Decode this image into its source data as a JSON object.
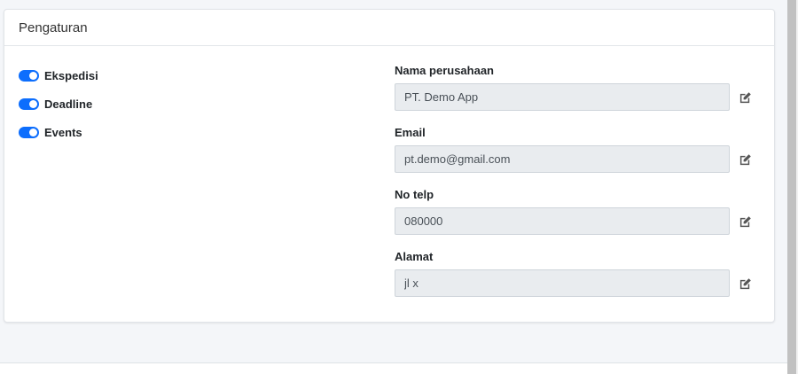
{
  "card": {
    "title": "Pengaturan"
  },
  "toggles": [
    {
      "label": "Ekspedisi",
      "enabled": true
    },
    {
      "label": "Deadline",
      "enabled": true
    },
    {
      "label": "Events",
      "enabled": true
    }
  ],
  "fields": [
    {
      "label": "Nama perusahaan",
      "value": "PT. Demo App",
      "icon": "edit-icon"
    },
    {
      "label": "Email",
      "value": "pt.demo@gmail.com",
      "icon": "edit-icon"
    },
    {
      "label": "No telp",
      "value": "080000",
      "icon": "edit-icon"
    },
    {
      "label": "Alamat",
      "value": "jl x",
      "icon": "edit-icon"
    }
  ],
  "colors": {
    "accent": "#0d6efd",
    "input_background": "#e9ecef",
    "page_background": "#f4f6f9"
  }
}
